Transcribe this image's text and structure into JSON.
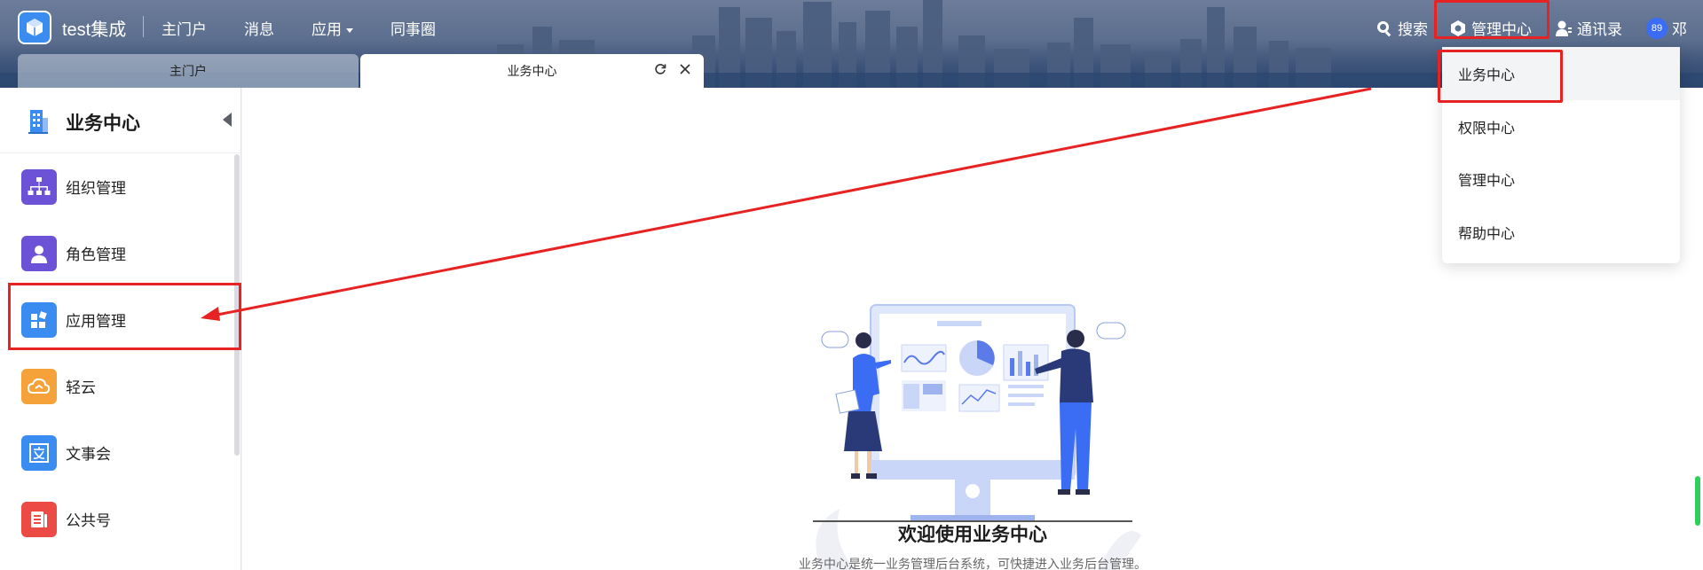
{
  "header": {
    "app_title": "test集成",
    "nav": [
      {
        "label": "主门户"
      },
      {
        "label": "消息"
      },
      {
        "label": "应用"
      },
      {
        "label": "同事圈"
      }
    ],
    "tools": {
      "search": "搜索",
      "admin": "管理中心",
      "contacts": "通讯录",
      "avatar_badge": "89",
      "user_name": "邓"
    }
  },
  "tabs": [
    {
      "label": "主门户"
    },
    {
      "label": "业务中心"
    }
  ],
  "sidebar": {
    "title": "业务中心",
    "items": [
      {
        "label": "组织管理",
        "icon": "org-chart-icon",
        "color": "#6b52d6"
      },
      {
        "label": "角色管理",
        "icon": "user-icon",
        "color": "#6b52d6"
      },
      {
        "label": "应用管理",
        "icon": "app-grid-icon",
        "color": "#3b8cf0"
      },
      {
        "label": "轻云",
        "icon": "cloud-icon",
        "color": "#f5a23a"
      },
      {
        "label": "文事会",
        "icon": "text-doc-icon",
        "color": "#3b8cf0"
      },
      {
        "label": "公共号",
        "icon": "notice-icon",
        "color": "#ec4b45"
      }
    ]
  },
  "main": {
    "welcome_title": "欢迎使用业务中心",
    "welcome_desc": "业务中心是统一业务管理后台系统，可快捷进入业务后台管理。"
  },
  "dropdown": {
    "items": [
      {
        "label": "业务中心"
      },
      {
        "label": "权限中心"
      },
      {
        "label": "管理中心"
      },
      {
        "label": "帮助中心"
      }
    ]
  },
  "colors": {
    "accent": "#3b8cf0",
    "highlight": "#e62222",
    "header_bg": "#3f557a"
  }
}
